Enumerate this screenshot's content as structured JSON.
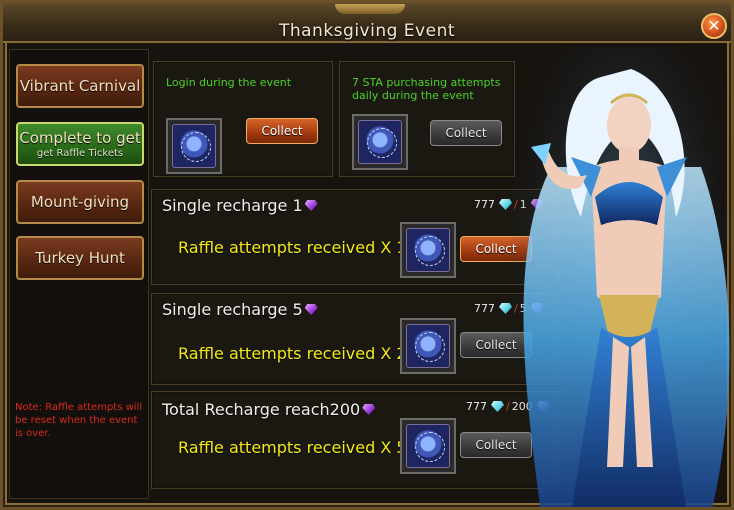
{
  "window": {
    "title": "Thanksgiving Event"
  },
  "sidebar": {
    "items": [
      {
        "label": "Vibrant Carnival",
        "sub": ""
      },
      {
        "label": "Complete to get",
        "sub": "get Raffle Tickets"
      },
      {
        "label": "Mount-giving",
        "sub": ""
      },
      {
        "label": "Turkey Hunt",
        "sub": ""
      }
    ],
    "note": "Note: Raffle attempts will be reset when the event is over."
  },
  "top_panels": [
    {
      "text": "Login during the event",
      "button": "Collect"
    },
    {
      "text": "7 STA purchasing attempts daily during the event",
      "button": "Collect"
    }
  ],
  "rows": [
    {
      "title": "Single recharge 1",
      "have": "777",
      "need": "1",
      "reward": "Raffle attempts received X 1",
      "button": "Collect"
    },
    {
      "title": "Single recharge 5",
      "have": "777",
      "need": "5",
      "reward": "Raffle attempts received X 2",
      "button": "Collect"
    },
    {
      "title": "Total Recharge reach200",
      "have": "777",
      "need": "200",
      "reward": "Raffle attempts received X 5",
      "button": "Collect"
    }
  ],
  "colors": {
    "accent_orange": "#a63d12",
    "active_green": "#2a6b1a",
    "reward_yellow": "#f3ea1c",
    "note_red": "#d82a1a"
  }
}
